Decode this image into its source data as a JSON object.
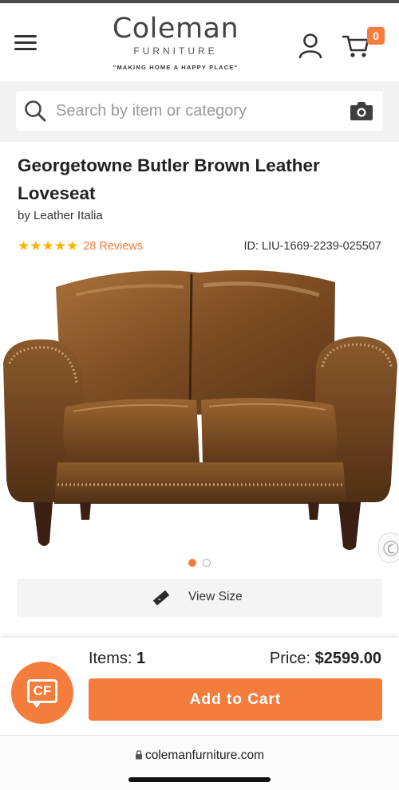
{
  "header": {
    "logo_main": "Coleman",
    "logo_sub": "FURNITURE",
    "logo_tagline": "\"MAKING HOME A HAPPY PLACE\"",
    "cart_count": "0",
    "menu_icon": "hamburger-menu-icon",
    "user_icon": "user-icon",
    "cart_icon": "cart-icon"
  },
  "search": {
    "placeholder": "Search by item or category",
    "value": "",
    "search_icon": "search-icon",
    "camera_icon": "camera-icon"
  },
  "product": {
    "title": "Georgetowne Butler Brown Leather Loveseat",
    "brand_line": "by Leather Italia",
    "stars": "★★★★★",
    "rating": 5,
    "reviews_label": "28 Reviews",
    "id_label": "ID: LIU-1669-2239-025507",
    "image_count": 2,
    "active_image": 1,
    "view_size_label": "View Size"
  },
  "cart_bar": {
    "items_label": "Items:",
    "items_value": "1",
    "price_label": "Price:",
    "price_value": "$2599.00",
    "add_to_cart_label": "Add to Cart",
    "chat_label": "CF"
  },
  "browser": {
    "url": "colemanfurniture.com"
  },
  "colors": {
    "accent": "#f47c3c",
    "star": "#f7b500",
    "text": "#222222",
    "search_bg": "#f2f2f2"
  }
}
